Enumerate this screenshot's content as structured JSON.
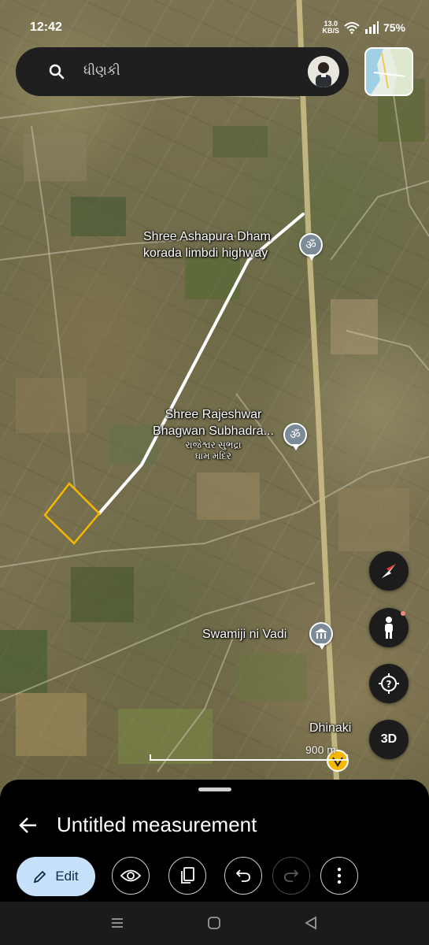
{
  "status": {
    "time": "12:42",
    "speed_value": "13.0",
    "speed_unit": "KB/S",
    "battery": "75%"
  },
  "search": {
    "query": "ધીણકી"
  },
  "places": [
    {
      "line1": "Shree Ashapura Dham",
      "line2": "korada limbdi highway",
      "pin_icon": "om-symbol"
    },
    {
      "line1": "Shree Rajeshwar",
      "line2": "Bhagwan Subhadra...",
      "sub1": "રાજેશ્વર સુભદ્રા",
      "sub2": "ધામ મંદિર",
      "pin_icon": "om-symbol"
    },
    {
      "line1": "Swamiji ni Vadi",
      "pin_icon": "temple-icon"
    },
    {
      "line1": "Dhinaki"
    }
  ],
  "map_controls": {
    "three_d_label": "3D",
    "scale_label": "900 m"
  },
  "measurement": {
    "path_color": "#ffffff",
    "polygon_color": "#f5b800"
  },
  "sheet": {
    "title": "Untitled measurement",
    "edit_label": "Edit"
  }
}
